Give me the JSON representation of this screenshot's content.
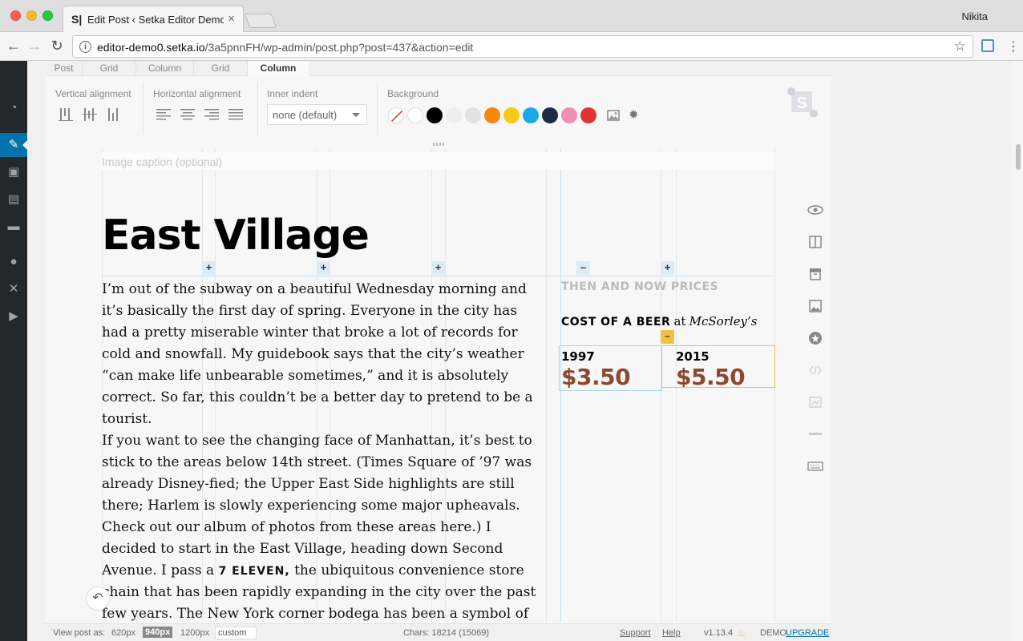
{
  "browser": {
    "tab_title": "Edit Post ‹ Setka Editor Demo",
    "tab_favicon": "S|",
    "profile_name": "Nikita",
    "url_host": "editor-demo0.setka.io",
    "url_path": "/3a5pnnFH/wp-admin/post.php?post=437&action=edit"
  },
  "breadcrumbs": [
    "Post",
    "Grid",
    "Column",
    "Grid",
    "Column"
  ],
  "toolbar": {
    "vertical_alignment_label": "Vertical alignment",
    "horizontal_alignment_label": "Horizontal alignment",
    "inner_indent_label": "Inner indent",
    "inner_indent_value": "none (default)",
    "background_label": "Background",
    "background_swatches": [
      "none",
      "#ffffff",
      "#000000",
      "#eeeeee",
      "#e2e2e2",
      "#f5870a",
      "#f7c815",
      "#19a9e8",
      "#1e2a48",
      "#ef8fb4",
      "#e03232"
    ]
  },
  "canvas": {
    "caption_placeholder": "Image caption (optional)",
    "headline": "East Village",
    "paragraph1": "I’m out of the subway on a beautiful Wednesday morning and it’s basically the first day of spring. Everyone in the city has had a pretty miserable winter that broke a lot of records for cold and snowfall. My guidebook says that the city’s weather “can make life unbearable sometimes,” and it is absolutely correct. So far, this couldn’t be a better day to pretend to be a tourist.",
    "paragraph2_before": "If you want to see the changing face of Manhattan, it’s best to stick to the areas below 14th street. (Times Square of ’97 was already Disney-fied; the Upper East Side highlights are still there; Harlem is slowly experiencing some major upheavals. Check out our album of photos from these areas here.) I decided to start in the East Village, heading down Second Avenue. I pass a",
    "paragraph2_caps": "7 ELEVEN,",
    "paragraph2_after": "the ubiquitous convenience store chain that has been rapidly expanding in the city over the past few years. The New York corner bodega has been a symbol of locally-owned pride for decades and the Slurpee-slinging franchise of the",
    "sidebar_eyebrow": "THEN AND NOW PRICES",
    "beer_label": "COST OF A BEER",
    "beer_at": "at",
    "beer_place": "McSorley’s",
    "year1": "1997",
    "price1": "$3.50",
    "year2": "2015",
    "price2": "$5.50",
    "plus_label": "+",
    "minus_label": "–"
  },
  "statusbar": {
    "view_post_as": "View post as:",
    "sizes": [
      "620px",
      "940px",
      "1200px"
    ],
    "active_size": "940px",
    "custom_placeholder": "custom",
    "chars": "Chars: 18214 (15069)",
    "support": "Support",
    "help": "Help",
    "version": "v1.13.4",
    "demo": "DEMO",
    "upgrade": "UPGRADE"
  },
  "colors": {
    "wp_sidebar": "#23282d",
    "wp_active": "#0073aa",
    "price_brown": "#8b4a2f",
    "guide_blue": "#c6e2f0",
    "handle_yellow": "#f2c042"
  }
}
